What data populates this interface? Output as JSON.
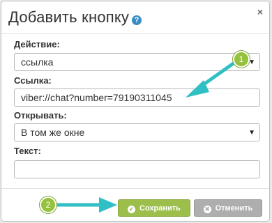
{
  "dialog": {
    "title": "Добавить кнопку",
    "help_icon": "?",
    "close_icon": "×"
  },
  "form": {
    "action_label": "Действие:",
    "action_value": "ссылка",
    "link_label": "Ссылка:",
    "link_value": "viber://chat?number=79190311045",
    "open_label": "Открывать:",
    "open_value": "В том же окне",
    "text_label": "Текст:",
    "text_value": ""
  },
  "buttons": {
    "save_label": "Сохранить",
    "cancel_label": "Отменить"
  },
  "annotations": {
    "badge_1": "1",
    "badge_2": "2",
    "arrow_color": "#2fbfc4",
    "badge_color": "#95c23d"
  }
}
